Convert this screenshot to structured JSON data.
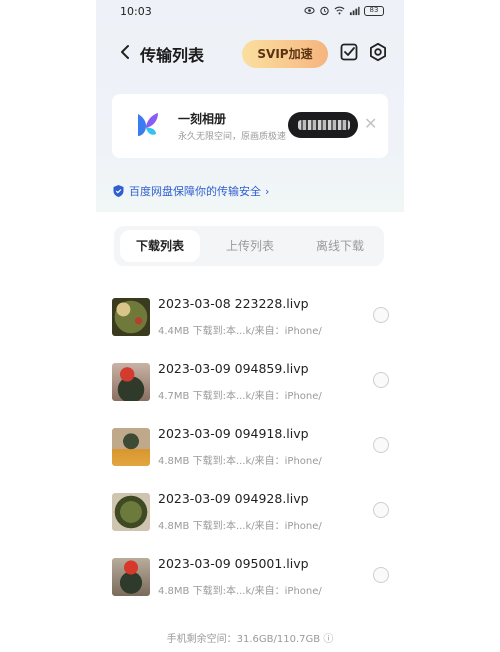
{
  "status_bar": {
    "time": "10:03",
    "battery": "83"
  },
  "nav": {
    "title": "传输列表",
    "svip_label": "SVIP加速"
  },
  "album_banner": {
    "title": "一刻相册",
    "subtitle": "永久无限空间，原画质极速"
  },
  "security": {
    "text": "百度网盘保障你的传输安全",
    "chevron": "›"
  },
  "tabs": [
    {
      "label": "下载列表",
      "active": true
    },
    {
      "label": "上传列表",
      "active": false
    },
    {
      "label": "离线下载",
      "active": false
    }
  ],
  "files": [
    {
      "name": "2023-03-08 223228.livp",
      "meta": "4.4MB  下载到:本...k/来自：iPhone/"
    },
    {
      "name": "2023-03-09 094859.livp",
      "meta": "4.7MB  下载到:本...k/来自：iPhone/"
    },
    {
      "name": "2023-03-09 094918.livp",
      "meta": "4.8MB  下载到:本...k/来自：iPhone/"
    },
    {
      "name": "2023-03-09 094928.livp",
      "meta": "4.8MB  下载到:本...k/来自：iPhone/"
    },
    {
      "name": "2023-03-09 095001.livp",
      "meta": "4.8MB  下载到:本...k/来自：iPhone/"
    }
  ],
  "storage": {
    "text": "手机剩余空间：31.6GB/110.7GB ⓘ"
  },
  "colors": {
    "accent_blue": "#2f5ecf",
    "svip_gold": "#f8c78d",
    "text_gray": "#9a9a9a"
  }
}
